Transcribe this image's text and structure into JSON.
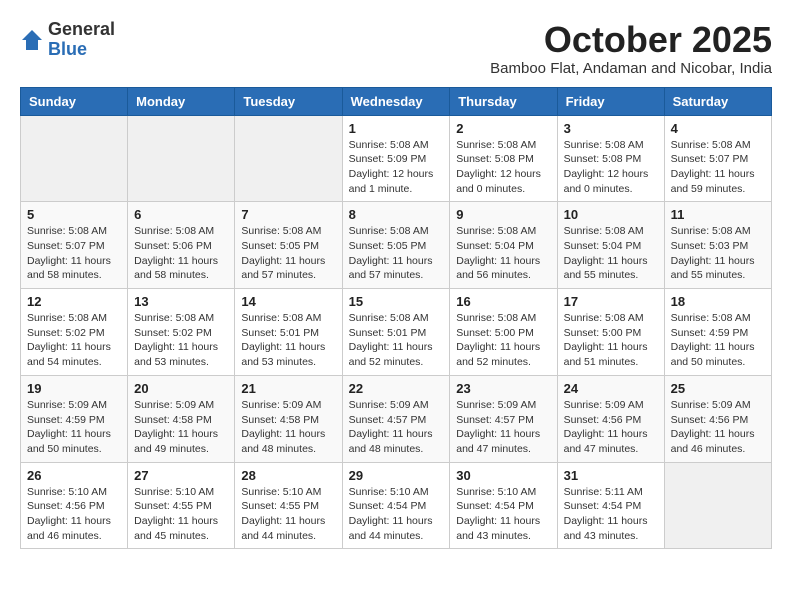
{
  "header": {
    "logo_general": "General",
    "logo_blue": "Blue",
    "month_title": "October 2025",
    "subtitle": "Bamboo Flat, Andaman and Nicobar, India"
  },
  "days_of_week": [
    "Sunday",
    "Monday",
    "Tuesday",
    "Wednesday",
    "Thursday",
    "Friday",
    "Saturday"
  ],
  "weeks": [
    [
      {
        "day": "",
        "info": ""
      },
      {
        "day": "",
        "info": ""
      },
      {
        "day": "",
        "info": ""
      },
      {
        "day": "1",
        "info": "Sunrise: 5:08 AM\nSunset: 5:09 PM\nDaylight: 12 hours\nand 1 minute."
      },
      {
        "day": "2",
        "info": "Sunrise: 5:08 AM\nSunset: 5:08 PM\nDaylight: 12 hours\nand 0 minutes."
      },
      {
        "day": "3",
        "info": "Sunrise: 5:08 AM\nSunset: 5:08 PM\nDaylight: 12 hours\nand 0 minutes."
      },
      {
        "day": "4",
        "info": "Sunrise: 5:08 AM\nSunset: 5:07 PM\nDaylight: 11 hours\nand 59 minutes."
      }
    ],
    [
      {
        "day": "5",
        "info": "Sunrise: 5:08 AM\nSunset: 5:07 PM\nDaylight: 11 hours\nand 58 minutes."
      },
      {
        "day": "6",
        "info": "Sunrise: 5:08 AM\nSunset: 5:06 PM\nDaylight: 11 hours\nand 58 minutes."
      },
      {
        "day": "7",
        "info": "Sunrise: 5:08 AM\nSunset: 5:05 PM\nDaylight: 11 hours\nand 57 minutes."
      },
      {
        "day": "8",
        "info": "Sunrise: 5:08 AM\nSunset: 5:05 PM\nDaylight: 11 hours\nand 57 minutes."
      },
      {
        "day": "9",
        "info": "Sunrise: 5:08 AM\nSunset: 5:04 PM\nDaylight: 11 hours\nand 56 minutes."
      },
      {
        "day": "10",
        "info": "Sunrise: 5:08 AM\nSunset: 5:04 PM\nDaylight: 11 hours\nand 55 minutes."
      },
      {
        "day": "11",
        "info": "Sunrise: 5:08 AM\nSunset: 5:03 PM\nDaylight: 11 hours\nand 55 minutes."
      }
    ],
    [
      {
        "day": "12",
        "info": "Sunrise: 5:08 AM\nSunset: 5:02 PM\nDaylight: 11 hours\nand 54 minutes."
      },
      {
        "day": "13",
        "info": "Sunrise: 5:08 AM\nSunset: 5:02 PM\nDaylight: 11 hours\nand 53 minutes."
      },
      {
        "day": "14",
        "info": "Sunrise: 5:08 AM\nSunset: 5:01 PM\nDaylight: 11 hours\nand 53 minutes."
      },
      {
        "day": "15",
        "info": "Sunrise: 5:08 AM\nSunset: 5:01 PM\nDaylight: 11 hours\nand 52 minutes."
      },
      {
        "day": "16",
        "info": "Sunrise: 5:08 AM\nSunset: 5:00 PM\nDaylight: 11 hours\nand 52 minutes."
      },
      {
        "day": "17",
        "info": "Sunrise: 5:08 AM\nSunset: 5:00 PM\nDaylight: 11 hours\nand 51 minutes."
      },
      {
        "day": "18",
        "info": "Sunrise: 5:08 AM\nSunset: 4:59 PM\nDaylight: 11 hours\nand 50 minutes."
      }
    ],
    [
      {
        "day": "19",
        "info": "Sunrise: 5:09 AM\nSunset: 4:59 PM\nDaylight: 11 hours\nand 50 minutes."
      },
      {
        "day": "20",
        "info": "Sunrise: 5:09 AM\nSunset: 4:58 PM\nDaylight: 11 hours\nand 49 minutes."
      },
      {
        "day": "21",
        "info": "Sunrise: 5:09 AM\nSunset: 4:58 PM\nDaylight: 11 hours\nand 48 minutes."
      },
      {
        "day": "22",
        "info": "Sunrise: 5:09 AM\nSunset: 4:57 PM\nDaylight: 11 hours\nand 48 minutes."
      },
      {
        "day": "23",
        "info": "Sunrise: 5:09 AM\nSunset: 4:57 PM\nDaylight: 11 hours\nand 47 minutes."
      },
      {
        "day": "24",
        "info": "Sunrise: 5:09 AM\nSunset: 4:56 PM\nDaylight: 11 hours\nand 47 minutes."
      },
      {
        "day": "25",
        "info": "Sunrise: 5:09 AM\nSunset: 4:56 PM\nDaylight: 11 hours\nand 46 minutes."
      }
    ],
    [
      {
        "day": "26",
        "info": "Sunrise: 5:10 AM\nSunset: 4:56 PM\nDaylight: 11 hours\nand 46 minutes."
      },
      {
        "day": "27",
        "info": "Sunrise: 5:10 AM\nSunset: 4:55 PM\nDaylight: 11 hours\nand 45 minutes."
      },
      {
        "day": "28",
        "info": "Sunrise: 5:10 AM\nSunset: 4:55 PM\nDaylight: 11 hours\nand 44 minutes."
      },
      {
        "day": "29",
        "info": "Sunrise: 5:10 AM\nSunset: 4:54 PM\nDaylight: 11 hours\nand 44 minutes."
      },
      {
        "day": "30",
        "info": "Sunrise: 5:10 AM\nSunset: 4:54 PM\nDaylight: 11 hours\nand 43 minutes."
      },
      {
        "day": "31",
        "info": "Sunrise: 5:11 AM\nSunset: 4:54 PM\nDaylight: 11 hours\nand 43 minutes."
      },
      {
        "day": "",
        "info": ""
      }
    ]
  ]
}
